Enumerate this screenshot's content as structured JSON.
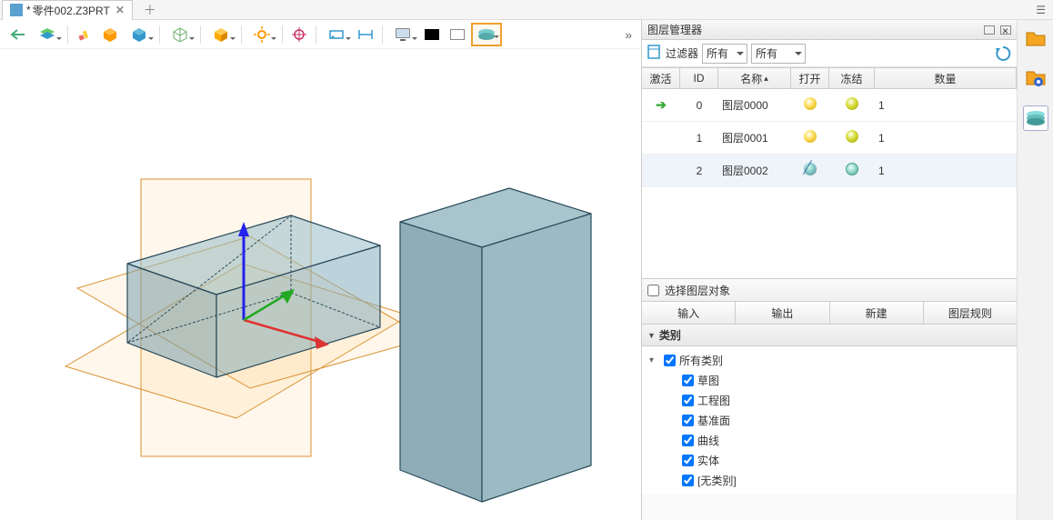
{
  "tab": {
    "filename": "零件002.Z3PRT",
    "modified": "*"
  },
  "panel": {
    "title": "图层管理器"
  },
  "filter": {
    "label": "过滤器",
    "sel1": "所有",
    "sel2": "所有"
  },
  "layer_headers": {
    "active": "激活",
    "id": "ID",
    "name": "名称",
    "open": "打开",
    "frozen": "冻结",
    "count": "数量"
  },
  "layers": [
    {
      "active": true,
      "id": "0",
      "name": "图层0000",
      "open": "on",
      "frozen": "on",
      "count": "1"
    },
    {
      "active": false,
      "id": "1",
      "name": "图层0001",
      "open": "on",
      "frozen": "on",
      "count": "1"
    },
    {
      "active": false,
      "id": "2",
      "name": "图层0002",
      "open": "off",
      "frozen": "cyan",
      "count": "1"
    }
  ],
  "select_obj_label": "选择图层对象",
  "buttons": {
    "input": "输入",
    "output": "输出",
    "new": "新建",
    "rule": "图层规则"
  },
  "category": {
    "header": "类别",
    "root": "所有类别",
    "items": [
      "草图",
      "工程图",
      "基准面",
      "曲线",
      "实体",
      "[无类别]"
    ]
  }
}
